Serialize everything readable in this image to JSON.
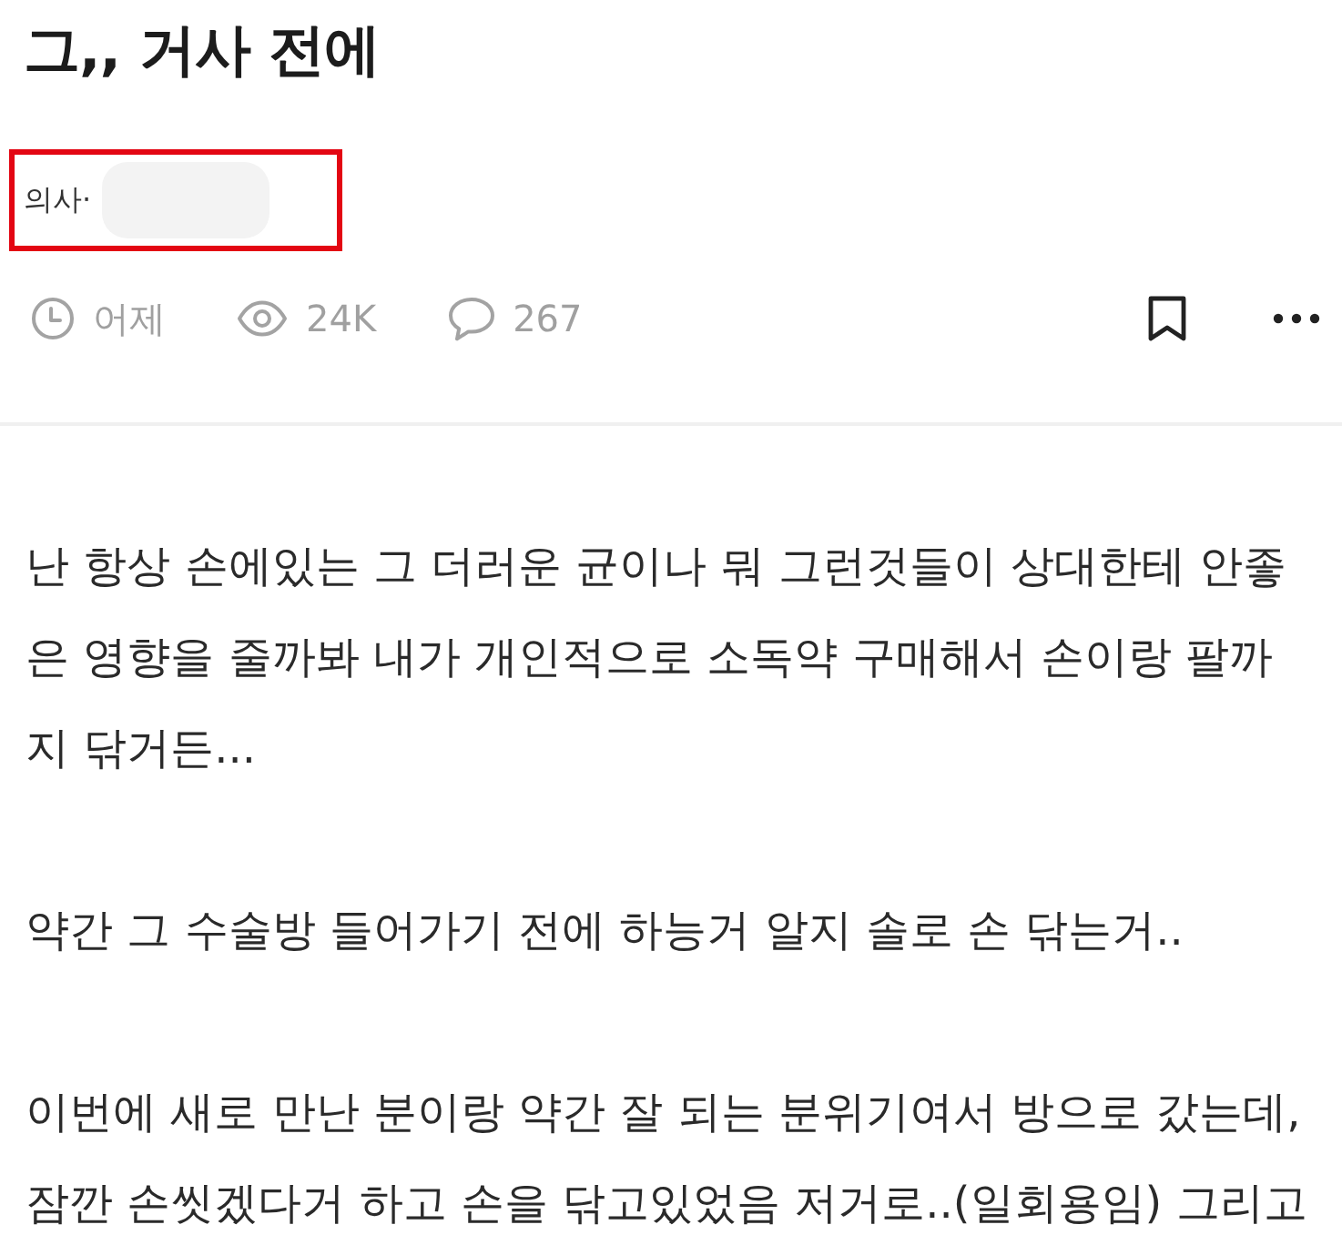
{
  "post": {
    "title": "그,, 거사 전에",
    "author": {
      "prefix": "의사·",
      "highlighted": true
    },
    "meta": [
      {
        "kind": "time",
        "text": "어제"
      },
      {
        "kind": "views",
        "text": "24K"
      },
      {
        "kind": "comments",
        "text": "267"
      }
    ],
    "actions": [
      {
        "kind": "bookmark",
        "bookmarked": false
      },
      {
        "kind": "more"
      }
    ],
    "paragraphs": [
      {
        "lines": [
          "난 항상 손에있는 그 더러운 균이나 뭐 그런것들이 상대한테 안좋",
          "은 영향을 줄까봐 내가 개인적으로 소독약 구매해서 손이랑 팔까",
          "지 닦거든..."
        ]
      },
      {
        "lines": [
          "약간 그 수술방 들어가기 전에 하능거 알지 솔로 손 닦는거.."
        ]
      },
      {
        "lines": [
          "이번에 새로 만난 분이랑 약간 잘 되는 분위기여서 방으로 갔는데,",
          "잠깐 손씻겠다거 하고 손을 닦고있었음 저거로..(일회용임) 그리고"
        ]
      }
    ]
  }
}
